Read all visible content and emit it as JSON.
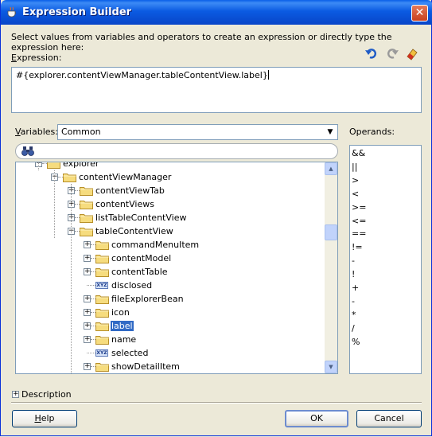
{
  "window": {
    "title": "Expression Builder",
    "close_symbol": "✕"
  },
  "instructions": "Select values from variables and operators to create an expression or directly type the expression here:",
  "expression": {
    "label_accel": "E",
    "label_rest": "xpression:",
    "value": "#{explorer.contentViewManager.tableContentView.label}"
  },
  "toolbar": {
    "undo_icon": "undo-icon",
    "redo_icon": "redo-icon",
    "clear_icon": "eraser-icon"
  },
  "variables": {
    "label_accel": "V",
    "label_rest": "ariables:",
    "selected": "Common"
  },
  "operands": {
    "label": "Operands:",
    "items": [
      "&&",
      "||",
      ">",
      "<",
      ">=",
      "<=",
      "==",
      "!=",
      "-",
      "!",
      "+",
      "-",
      "*",
      "/",
      "%"
    ]
  },
  "tree": {
    "items": [
      {
        "label": "explorer",
        "kind": "folder",
        "level": 1,
        "expander": "−"
      },
      {
        "label": "contentViewManager",
        "kind": "folder",
        "level": 2,
        "expander": "−"
      },
      {
        "label": "contentViewTab",
        "kind": "folder",
        "level": 3,
        "expander": "+"
      },
      {
        "label": "contentViews",
        "kind": "folder",
        "level": 3,
        "expander": "+"
      },
      {
        "label": "listTableContentView",
        "kind": "folder",
        "level": 3,
        "expander": "+"
      },
      {
        "label": "tableContentView",
        "kind": "folder",
        "level": 3,
        "expander": "−"
      },
      {
        "label": "commandMenuItem",
        "kind": "folder",
        "level": 4,
        "expander": "+"
      },
      {
        "label": "contentModel",
        "kind": "folder",
        "level": 4,
        "expander": "+"
      },
      {
        "label": "contentTable",
        "kind": "folder",
        "level": 4,
        "expander": "+"
      },
      {
        "label": "disclosed",
        "kind": "value",
        "level": 4,
        "expander": ""
      },
      {
        "label": "fileExplorerBean",
        "kind": "folder",
        "level": 4,
        "expander": "+"
      },
      {
        "label": "icon",
        "kind": "folder",
        "level": 4,
        "expander": "+"
      },
      {
        "label": "label",
        "kind": "folder",
        "level": 4,
        "expander": "+",
        "selected": true
      },
      {
        "label": "name",
        "kind": "folder",
        "level": 4,
        "expander": "+"
      },
      {
        "label": "selected",
        "kind": "value",
        "level": 4,
        "expander": ""
      },
      {
        "label": "showDetailItem",
        "kind": "folder",
        "level": 4,
        "expander": "+"
      }
    ],
    "value_badge": "XYZ"
  },
  "description": {
    "label": "Description",
    "expander": "+"
  },
  "buttons": {
    "help_accel": "H",
    "help_rest": "elp",
    "ok": "OK",
    "cancel": "Cancel"
  },
  "colors": {
    "titlebar": "#0A5FE8",
    "selection": "#316AC5",
    "dialog_bg": "#ECE9D8"
  }
}
